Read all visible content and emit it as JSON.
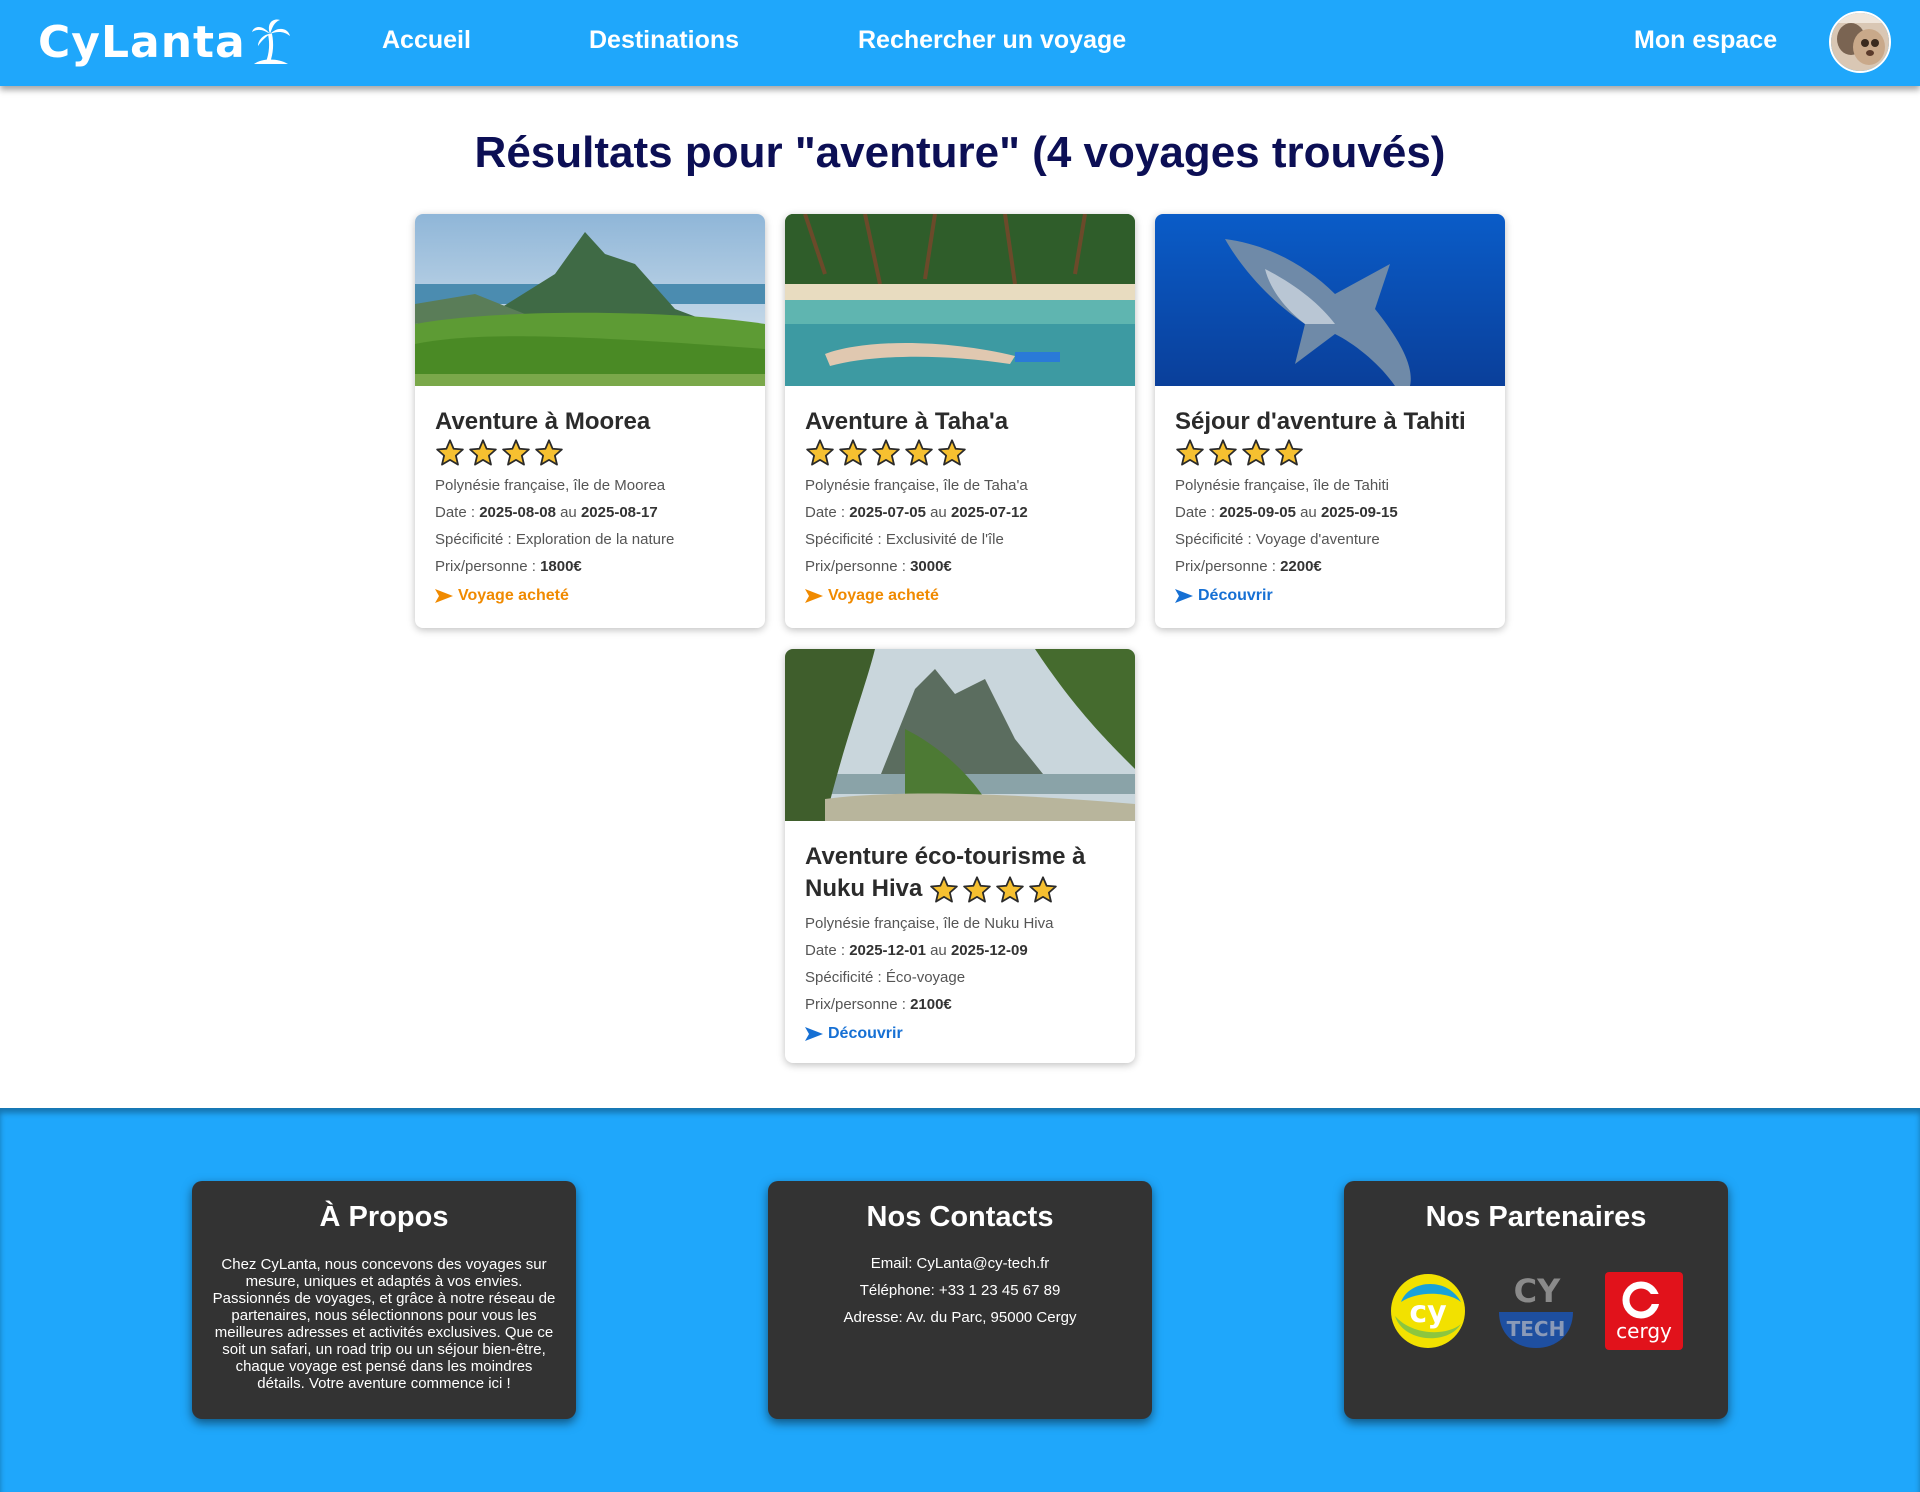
{
  "header": {
    "logo_text": "CyLanta",
    "nav": {
      "home": "Accueil",
      "destinations": "Destinations",
      "search": "Rechercher un voyage",
      "account": "Mon espace"
    }
  },
  "page": {
    "title": "Résultats pour \"aventure\" (4 voyages trouvés)"
  },
  "labels": {
    "date": "Date : ",
    "date_sep": " au ",
    "specificity": "Spécificité : ",
    "price": "Prix/personne : "
  },
  "cards": [
    {
      "title": "Aventure à Moorea",
      "stars": 4,
      "location": "Polynésie française, île de Moorea",
      "date_start": "2025-08-08",
      "date_end": "2025-08-17",
      "specificity": "Exploration de la nature",
      "price": "1800€",
      "link": "Voyage acheté",
      "link_color": "#f08a00"
    },
    {
      "title": "Aventure à Taha'a",
      "stars": 5,
      "location": "Polynésie française, île de Taha'a",
      "date_start": "2025-07-05",
      "date_end": "2025-07-12",
      "specificity": "Exclusivité de l'île",
      "price": "3000€",
      "link": "Voyage acheté",
      "link_color": "#f08a00"
    },
    {
      "title": "Séjour d'aventure à Tahiti",
      "stars": 4,
      "location": "Polynésie française, île de Tahiti",
      "date_start": "2025-09-05",
      "date_end": "2025-09-15",
      "specificity": "Voyage d'aventure",
      "price": "2200€",
      "link": "Découvrir",
      "link_color": "#1670d4"
    },
    {
      "title": "Aventure éco-tourisme à Nuku Hiva",
      "stars": 4,
      "location": "Polynésie française, île de Nuku Hiva",
      "date_start": "2025-12-01",
      "date_end": "2025-12-09",
      "specificity": "Éco-voyage",
      "price": "2100€",
      "link": "Découvrir",
      "link_color": "#1670d4"
    }
  ],
  "footer": {
    "about": {
      "title": "À Propos",
      "text": "Chez CyLanta, nous concevons des voyages sur mesure, uniques et adaptés à vos envies. Passionnés de voyages, et grâce à notre réseau de partenaires, nous sélectionnons pour vous les meilleures adresses et activités exclusives. Que ce soit un safari, un road trip ou un séjour bien-être, chaque voyage est pensé dans les moindres détails. Votre aventure commence ici !"
    },
    "contacts": {
      "title": "Nos Contacts",
      "email": "Email: CyLanta@cy-tech.fr",
      "phone": "Téléphone: +33 1 23 45 67 89",
      "address": "Adresse: Av. du Parc, 95000 Cergy"
    },
    "partners": {
      "title": "Nos Partenaires",
      "logos": [
        "cy",
        "CY TECH",
        "cergy"
      ]
    }
  },
  "colors": {
    "primary": "#1fa7fb",
    "title": "#0c0f55",
    "footer_box": "#333333",
    "star": "#f6c030"
  }
}
